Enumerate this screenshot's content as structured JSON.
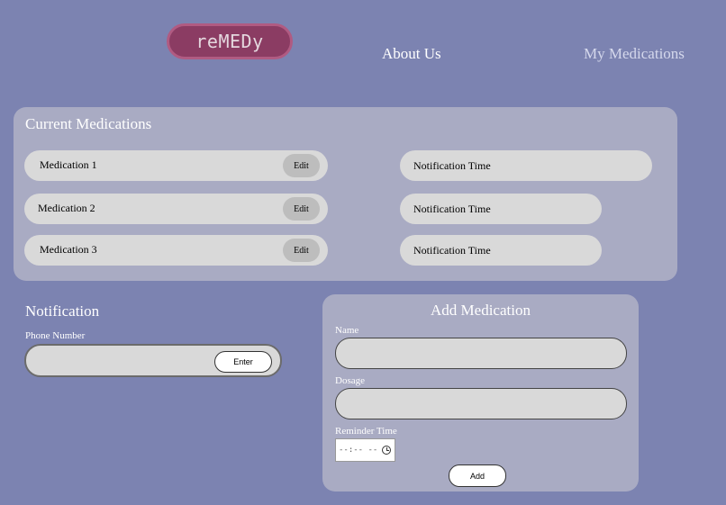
{
  "header": {
    "logo": "reMEDy",
    "nav": {
      "about": "About Us",
      "medications": "My Medications"
    }
  },
  "current_medications": {
    "title": "Current Medications",
    "edit_label": "Edit",
    "items": [
      {
        "name": "Medication 1",
        "notification": "Notification Time"
      },
      {
        "name": "Medication 2",
        "notification": "Notification Time"
      },
      {
        "name": "Medication 3",
        "notification": "Notification Time"
      }
    ]
  },
  "notification": {
    "title": "Notification",
    "phone_label": "Phone Number",
    "phone_value": "",
    "enter_label": "Enter"
  },
  "add_medication": {
    "title": "Add Medication",
    "name_label": "Name",
    "name_value": "",
    "dosage_label": "Dosage",
    "dosage_value": "",
    "reminder_label": "Reminder Time",
    "reminder_value": "--:-- --",
    "add_label": "Add"
  },
  "colors": {
    "background": "#7c83b1",
    "panel": "#a9abc3",
    "logo": "#8b3c63",
    "pill": "#d9d9d9"
  },
  "icons": {
    "time_picker": "clock-icon"
  }
}
